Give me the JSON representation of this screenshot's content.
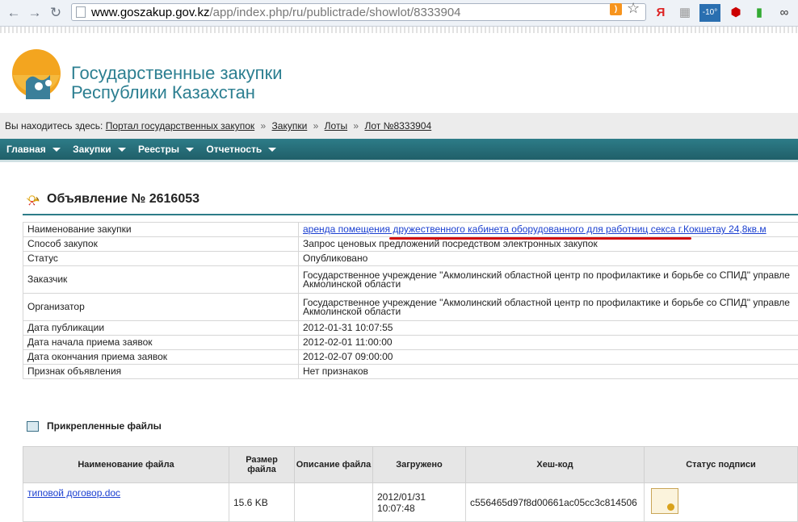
{
  "browser": {
    "url_domain": "www.goszakup.gov.kz",
    "url_path": "/app/index.php/ru/publictrade/showlot/8333904",
    "extensions": [
      "Я",
      "-10°"
    ]
  },
  "header": {
    "title_line1": "Государственные закупки",
    "title_line2": "Республики Казахстан"
  },
  "breadcrumbs": {
    "prefix": "Вы находитесь здесь:",
    "items": [
      "Портал государственных закупок",
      "Закупки",
      "Лоты",
      "Лот №8333904"
    ],
    "separator": "»"
  },
  "menu": [
    "Главная",
    "Закупки",
    "Реестры",
    "Отчетность"
  ],
  "announcement": {
    "title": "Объявление № 2616053",
    "rows": [
      {
        "label": "Наименование закупки",
        "value": "аренда помещения дружественного кабинета оборудованного для работниц секса г.Кокшетау 24,8кв.м"
      },
      {
        "label": "Способ закупок",
        "value": "Запрос ценовых предложений посредством электронных закупок"
      },
      {
        "label": "Статус",
        "value": "Опубликовано"
      },
      {
        "label": "Заказчик",
        "value": "Государственное учреждение \"Акмолинский областной центр по профилактике и борьбе со СПИД\" управле",
        "value2": "Акмолинской области"
      },
      {
        "label": "Организатор",
        "value": "Государственное учреждение \"Акмолинский областной центр по профилактике и борьбе со СПИД\" управле",
        "value2": "Акмолинской области"
      },
      {
        "label": "Дата публикации",
        "value": "2012-01-31 10:07:55"
      },
      {
        "label": "Дата начала приема заявок",
        "value": "2012-02-01 11:00:00"
      },
      {
        "label": "Дата окончания приема заявок",
        "value": "2012-02-07 09:00:00"
      },
      {
        "label": "Признак объявления",
        "value": "Нет признаков"
      }
    ]
  },
  "files": {
    "title": "Прикрепленные файлы",
    "columns": [
      "Наименование файла",
      "Размер файла",
      "Описание файла",
      "Загружено",
      "Хеш-код",
      "Статус подписи"
    ],
    "rows": [
      {
        "name": "типовой договор.doc",
        "size": "15.6 KB",
        "description": "",
        "uploaded": "2012/01/31 10:07:48",
        "hash": "c556465d97f8d00661ac05cc3c814506"
      }
    ]
  },
  "colors": {
    "accent": "#2d7c88",
    "link": "#1a3fd0",
    "highlight": "#d21010"
  }
}
